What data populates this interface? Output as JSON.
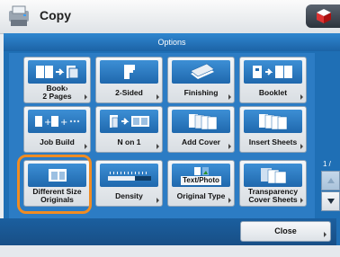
{
  "app": {
    "title": "Copy"
  },
  "header": {
    "title": "Options"
  },
  "buttons": [
    {
      "id": "book-2-pages",
      "label": "Book›\n2 Pages",
      "icon": "book-to-pages-icon"
    },
    {
      "id": "2-sided",
      "label": "2-Sided",
      "icon": "two-sided-icon"
    },
    {
      "id": "finishing",
      "label": "Finishing",
      "icon": "finishing-icon"
    },
    {
      "id": "booklet",
      "label": "Booklet",
      "icon": "booklet-icon"
    },
    {
      "id": "job-build",
      "label": "Job Build",
      "icon": "job-build-icon"
    },
    {
      "id": "n-on-1",
      "label": "N on 1",
      "icon": "n-on-1-icon"
    },
    {
      "id": "add-cover",
      "label": "Add Cover",
      "icon": "add-cover-icon"
    },
    {
      "id": "insert-sheets",
      "label": "Insert Sheets",
      "icon": "insert-sheets-icon"
    },
    {
      "id": "different-size-originals",
      "label": "Different Size\nOriginals",
      "icon": "different-size-originals-icon"
    },
    {
      "id": "density",
      "label": "Density",
      "icon": "density-slider-icon"
    },
    {
      "id": "original-type",
      "label": "Original Type",
      "icon": "text-photo-icon",
      "icon_text": "Text/Photo"
    },
    {
      "id": "transparency-cover-sheets",
      "label": "Transparency\nCover Sheets",
      "icon": "transparency-cover-sheets-icon"
    }
  ],
  "pagination": {
    "label": "1 /"
  },
  "footer": {
    "close_label": "Close"
  },
  "colors": {
    "highlight": "#f08c22",
    "panel": "#1f6fb5"
  }
}
